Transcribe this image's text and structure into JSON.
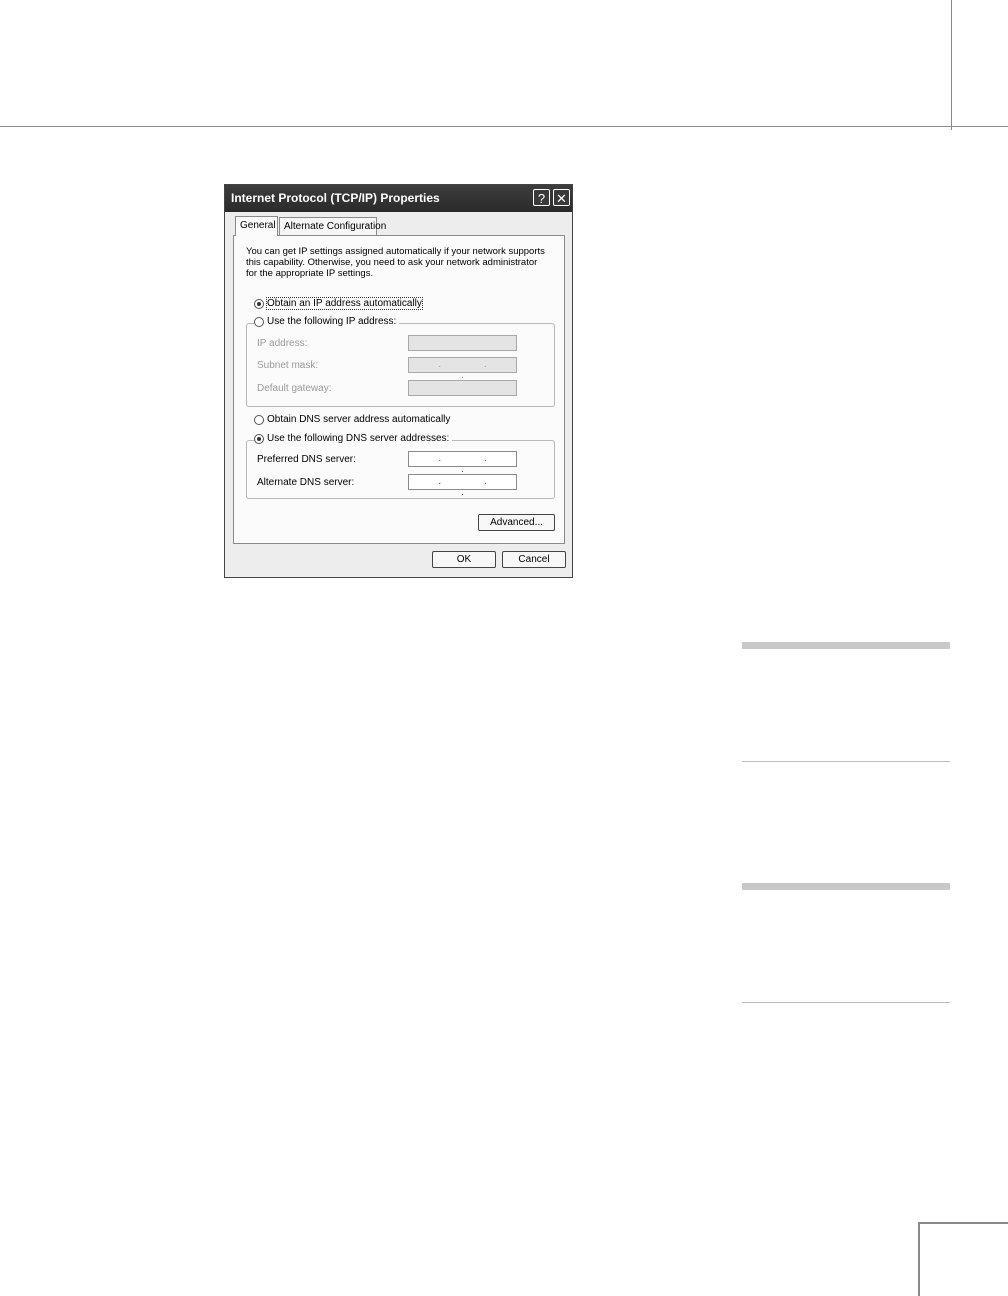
{
  "dialog": {
    "title": "Internet Protocol (TCP/IP) Properties",
    "help_glyph": "?",
    "close_glyph": "✕",
    "tabs": [
      {
        "label": "General",
        "selected": true
      },
      {
        "label": "Alternate Configuration",
        "selected": false
      }
    ],
    "intro": "You can get IP settings assigned automatically if your network supports this capability. Otherwise, you need to ask your network administrator for the appropriate IP settings.",
    "ip_mode": {
      "auto_label": "Obtain an IP address automatically",
      "manual_label": "Use the following IP address:",
      "selected": "auto"
    },
    "ip_fields": [
      {
        "label": "IP address:",
        "value": ""
      },
      {
        "label": "Subnet mask:",
        "value": ". . ."
      },
      {
        "label": "Default gateway:",
        "value": ""
      }
    ],
    "dns_mode": {
      "auto_label": "Obtain DNS server address automatically",
      "manual_label": "Use the following DNS server addresses:",
      "selected": "manual"
    },
    "dns_fields": [
      {
        "label": "Preferred DNS server:",
        "value": ". . ."
      },
      {
        "label": "Alternate DNS server:",
        "value": ". . ."
      }
    ],
    "advanced_label": "Advanced...",
    "ok_label": "OK",
    "cancel_label": "Cancel"
  }
}
